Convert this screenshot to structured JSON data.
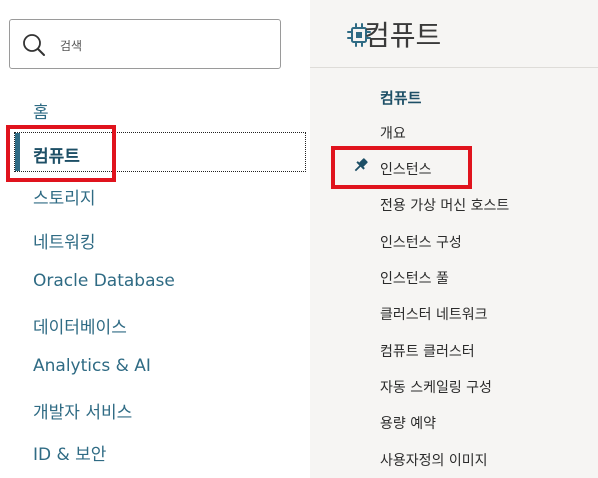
{
  "search": {
    "placeholder": "검색",
    "icon": "search-icon"
  },
  "nav": {
    "items": [
      {
        "label": "홈"
      },
      {
        "label": "컴퓨트",
        "active": true
      },
      {
        "label": "스토리지"
      },
      {
        "label": "네트워킹"
      },
      {
        "label": "Oracle Database"
      },
      {
        "label": "데이터베이스"
      },
      {
        "label": "Analytics & AI"
      },
      {
        "label": "개발자 서비스"
      },
      {
        "label": "ID & 보안"
      }
    ]
  },
  "panel": {
    "title": "컴퓨트",
    "title_icon": "chip-icon",
    "section_heading": "컴퓨트",
    "items": [
      {
        "label": "개요"
      },
      {
        "label": "인스턴스",
        "pinned": true
      },
      {
        "label": "전용 가상 머신 호스트"
      },
      {
        "label": "인스턴스 구성"
      },
      {
        "label": "인스턴스 풀"
      },
      {
        "label": "클러스터 네트워크"
      },
      {
        "label": "컴퓨트 클러스터"
      },
      {
        "label": "자동 스케일링 구성"
      },
      {
        "label": "용량 예약"
      },
      {
        "label": "사용자정의 이미지"
      }
    ]
  },
  "colors": {
    "accent": "#2f6b84",
    "highlight": "#e0131d",
    "panel_bg": "#f6f5f3"
  }
}
